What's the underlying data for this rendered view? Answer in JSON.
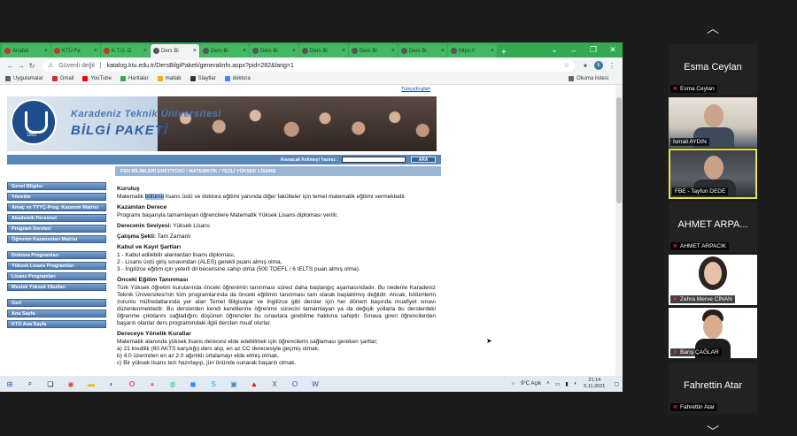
{
  "browser": {
    "tabs": [
      {
        "label": "Anabili",
        "active": false
      },
      {
        "label": "KTÜ Fe",
        "active": false
      },
      {
        "label": "K.T.Ü. D",
        "active": false
      },
      {
        "label": "Ders Bi",
        "active": true
      },
      {
        "label": "Ders Bi",
        "active": false
      },
      {
        "label": "Ders Bi",
        "active": false
      },
      {
        "label": "Ders Bi",
        "active": false
      },
      {
        "label": "Ders Bi",
        "active": false
      },
      {
        "label": "Ders Bi",
        "active": false
      },
      {
        "label": "https://",
        "active": false
      }
    ],
    "new_tab": "+",
    "security": "Güvenli değil",
    "url": "katalog.ktu.edu.tr/DersBilgiPaketi/generalinfo.aspx?pid=282&lang=1",
    "profile_initial": "k",
    "bookmarks": [
      {
        "label": "Uygulamalar",
        "color": "#5f6368"
      },
      {
        "label": "Gmail",
        "color": "#d93025"
      },
      {
        "label": "YouTube",
        "color": "#ff0000"
      },
      {
        "label": "Haritalar",
        "color": "#34a853"
      },
      {
        "label": "matlab",
        "color": "#f9ab00"
      },
      {
        "label": "Slaytlar",
        "color": "#333333"
      },
      {
        "label": "doktora",
        "color": "#4285f4"
      }
    ],
    "reading_list": "Okuma listesi"
  },
  "site": {
    "lang_links": "Türkçe|English",
    "seal_year": "1955",
    "univ_name": "Karadeniz Teknik Üniversitesi",
    "package_name": "BİLGİ PAKETİ",
    "search_label": "Aranacak Kelimeyi Yazınız :",
    "search_button": "ARA",
    "section_title": "FEN BİLİMLERİ ENSTİTÜSÜ / MATEMATİK / TEZLİ YÜKSEK LİSANS",
    "menu_group1": [
      "Genel Bilgiler",
      "Yönetim",
      "Amaç ve TYYÇ-Prog. Kazanım Matrisi",
      "Akademik Personel",
      "Program Dersleri",
      "Öğrenim Kazanımları Matrisi"
    ],
    "menu_group2": [
      "Doktora Programları",
      "Yüksek Lisans Programları",
      "Lisans Programları",
      "Meslek Yüksek Okulları"
    ],
    "menu_group3": [
      "Geri",
      "Ana Sayfa",
      "KTÜ Ana Sayfa"
    ]
  },
  "content": {
    "kurulus_h": "Kuruluş",
    "kurulus_a": "Matematik ",
    "kurulus_hl": "bölümü",
    "kurulus_b": " lisans üstü ve doktora eğitimi yanında diğer fakülteler için temel matematik eğitimi vermektedir.",
    "kazanilan_h": "Kazanılan Derece",
    "kazanilan_p": "Programı başarıyla tamamlayan öğrencilere Matematik Yüksek Lisans diploması verilir.",
    "seviye_label": "Derecenin Seviyesi:",
    "seviye_value": "Yüksek Lisans",
    "calisma_label": "Çalışma Şekli:",
    "calisma_value": "Tam Zamanlı",
    "kabul_h": "Kabul ve Kayıt Şartları",
    "kabul_1": "1 - Kabul edilebilir alanlardan lisans diploması,",
    "kabul_2": "2 - Lisans üstü giriş sınavından (ALES) gerekli puanı almış olma,",
    "kabul_3": "3 - İngilizce eğitim için yeterli dil becerisine sahip olma (500 TOEFL / 6 IELTS puan almış olma).",
    "onceki_h": "Önceki Eğitim Tanınması",
    "onceki_p": "Türk Yüksek öğretim kurularında önceki öğrenimin tanınması süreci daha başlangıç aşamasındadır. Bu nedenle Karadeniz Teknik Üniversitesi'nin tüm programlarında da önceki eğitimin tanınması tam olarak başlatılmış değildir. Ancak, bölümlerin zorunlu müfredatlarında yer alan Temel Bilgisayar ve İngilizce gibi dersler için her dönem başında muafiyet sınavı düzenlenmektedir. Bu derslerden kendi kendilerine öğrenme sürecini tamamlayan ya da değişik yollarla bu derslerdeki öğrenme çıktılarını sağladığını düşünen öğrenciler bu sınavlara girebilme hakkına sahiptir. Sınava giren öğrencilerden başarılı olanlar ders programındaki ilgili dersten muaf olurlar.",
    "dereceye_h": "Dereceye Yönelik Kurallar",
    "dereceye_p": "Matematik alanında yüksek lisans derecesi elde edebilmek için öğrencilerin sağlaması gereken şartlar;",
    "dereceye_a": "a) 21 kredilik (60 AKTS karşılığı) ders alıp, en az CC derecesiyle geçmiş olmak,",
    "dereceye_b": "b) 4.0 üzerinden en az 2.0 ağırlıklı ortalamayı elde etmiş olmak,",
    "dereceye_c": "c) Bir yüksek lisans tezi hazırlayıp, jüri önünde sunarak başarılı olmak."
  },
  "taskbar": {
    "weather": "9°C Açık",
    "time": "21:14",
    "date": "5.11.2021"
  },
  "participants": [
    {
      "name": "Esma Ceylan",
      "big_name": "Esma Ceylan",
      "video": false,
      "muted": true,
      "talking": false
    },
    {
      "name": "İsmail AYDIN",
      "video": true,
      "muted": false,
      "talking": false
    },
    {
      "name": "FBE - Tayfun DEDE",
      "video": true,
      "muted": false,
      "talking": true
    },
    {
      "name": "AHMET ARPACIK",
      "big_name": "AHMET ARPA...",
      "video": false,
      "muted": true,
      "talking": false
    },
    {
      "name": "Zehra Merve CİNAN",
      "video": true,
      "muted": true,
      "talking": false
    },
    {
      "name": "Barış ÇAĞLAR",
      "video": true,
      "muted": true,
      "talking": false
    },
    {
      "name": "Fahrettin Atar",
      "big_name": "Fahrettin Atar",
      "video": false,
      "muted": true,
      "talking": false
    }
  ]
}
